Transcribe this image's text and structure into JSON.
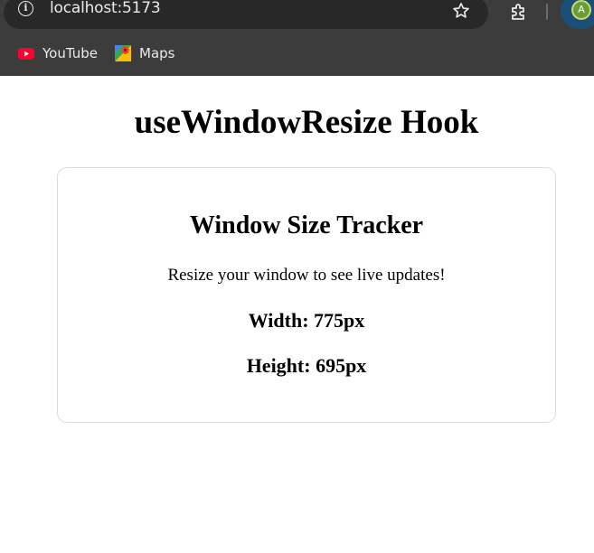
{
  "browser": {
    "url": "localhost:5173",
    "profile_initial": "A",
    "bookmarks": [
      {
        "label": "YouTube",
        "icon": "youtube-icon"
      },
      {
        "label": "Maps",
        "icon": "maps-icon"
      }
    ]
  },
  "page": {
    "title": "useWindowResize Hook",
    "card": {
      "title": "Window Size Tracker",
      "description": "Resize your window to see live updates!",
      "width_text": "Width: 775px",
      "height_text": "Height: 695px"
    }
  },
  "colors": {
    "chrome_bg": "#3c3c3c",
    "omnibox_bg": "#282828",
    "card_border": "#dcdcdc"
  }
}
